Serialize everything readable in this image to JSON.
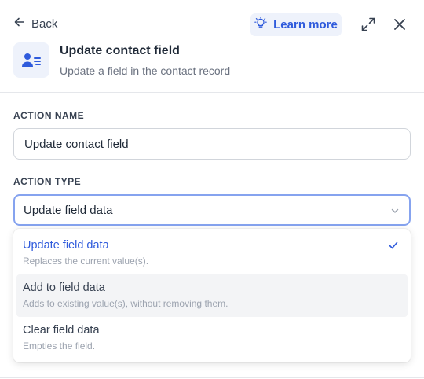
{
  "header": {
    "back_label": "Back",
    "learn_more_label": "Learn more",
    "title": "Update contact field",
    "subtitle": "Update a field in the contact record"
  },
  "form": {
    "action_name": {
      "label": "ACTION NAME",
      "value": "Update contact field"
    },
    "action_type": {
      "label": "ACTION TYPE",
      "selected": "Update field data",
      "options": [
        {
          "label": "Update field data",
          "description": "Replaces the current value(s).",
          "selected": true
        },
        {
          "label": "Add to field data",
          "description": "Adds to existing value(s), without removing them.",
          "hovered": true
        },
        {
          "label": "Clear field data",
          "description": "Empties the field."
        }
      ]
    }
  },
  "colors": {
    "accent": "#2f5bdc",
    "accent_bg": "#eef2fb",
    "focus_border": "#86a3ef"
  },
  "icons": {
    "back": "arrow-left-icon",
    "learn_more": "lightbulb-icon",
    "expand": "expand-icon",
    "close": "close-icon",
    "app": "contact-card-icon",
    "select": "chevron-down-icon",
    "selected_option": "check-icon"
  }
}
